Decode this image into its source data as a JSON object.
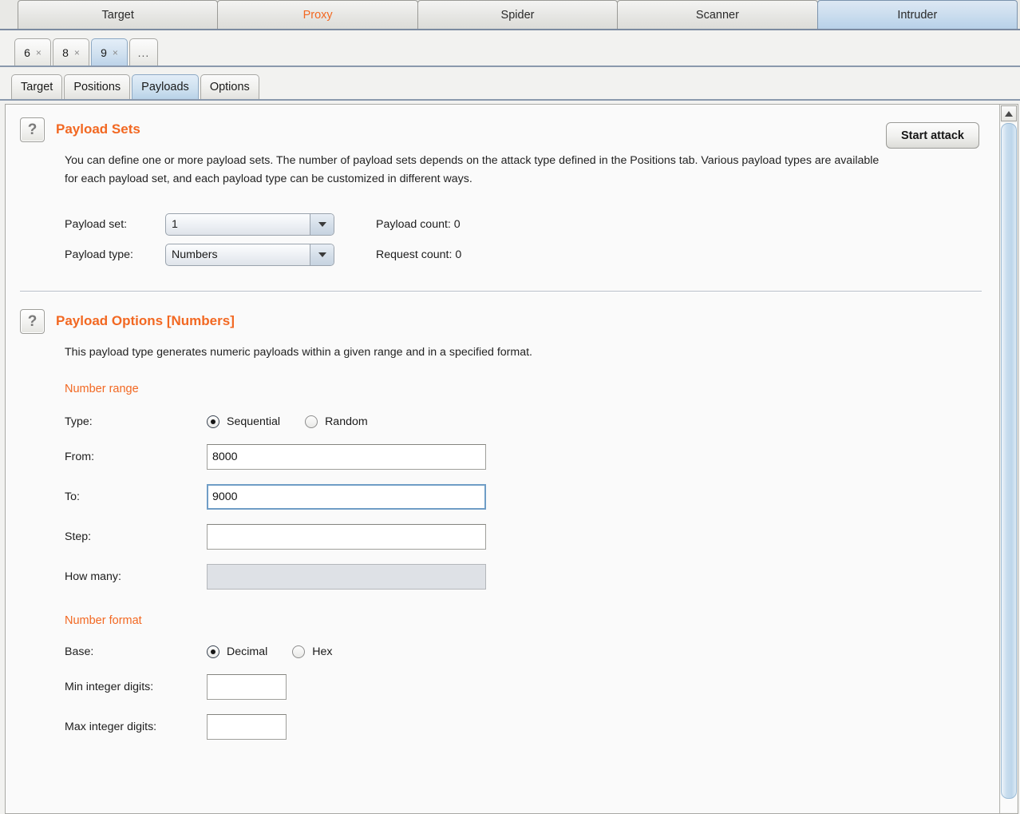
{
  "app_tabs": [
    {
      "label": "Target",
      "selected": false,
      "accent": false
    },
    {
      "label": "Proxy",
      "selected": false,
      "accent": true
    },
    {
      "label": "Spider",
      "selected": false,
      "accent": false
    },
    {
      "label": "Scanner",
      "selected": false,
      "accent": false
    },
    {
      "label": "Intruder",
      "selected": true,
      "accent": false
    }
  ],
  "attack_tabs": [
    {
      "label": "6",
      "close": "×",
      "selected": false
    },
    {
      "label": "8",
      "close": "×",
      "selected": false
    },
    {
      "label": "9",
      "close": "×",
      "selected": true
    }
  ],
  "attack_tabs_more": "...",
  "sub_tabs": [
    {
      "label": "Target",
      "selected": false
    },
    {
      "label": "Positions",
      "selected": false
    },
    {
      "label": "Payloads",
      "selected": true
    },
    {
      "label": "Options",
      "selected": false
    }
  ],
  "toolbar": {
    "start_attack_label": "Start attack"
  },
  "payload_sets": {
    "help_glyph": "?",
    "title": "Payload Sets",
    "description": "You can define one or more payload sets. The number of payload sets depends on the attack type defined in the Positions tab. Various payload types are available for each payload set, and each payload type can be customized in different ways.",
    "payload_set_label": "Payload set:",
    "payload_set_value": "1",
    "payload_type_label": "Payload type:",
    "payload_type_value": "Numbers",
    "payload_count_label": "Payload count:  0",
    "request_count_label": "Request count: 0"
  },
  "payload_options": {
    "help_glyph": "?",
    "title": "Payload Options [Numbers]",
    "description": "This payload type generates numeric payloads within a given range and in a specified format.",
    "number_range": {
      "group_title": "Number range",
      "type_label": "Type:",
      "type_options": [
        {
          "label": "Sequential",
          "checked": true
        },
        {
          "label": "Random",
          "checked": false
        }
      ],
      "from_label": "From:",
      "from_value": "8000",
      "to_label": "To:",
      "to_value": "9000",
      "to_focused": true,
      "step_label": "Step:",
      "step_value": "",
      "how_many_label": "How many:",
      "how_many_value": "",
      "how_many_disabled": true
    },
    "number_format": {
      "group_title": "Number format",
      "base_label": "Base:",
      "base_options": [
        {
          "label": "Decimal",
          "checked": true
        },
        {
          "label": "Hex",
          "checked": false
        }
      ],
      "min_digits_label": "Min integer digits:",
      "min_digits_value": "",
      "max_digits_label": "Max integer digits:",
      "max_digits_value": ""
    }
  },
  "scrollbar": {
    "up_arrow": "scroll-up-arrow"
  },
  "colors": {
    "accent_orange": "#f26822",
    "selected_tab_blue": "#bcd3e9",
    "focus_blue": "#6f9dc6"
  }
}
